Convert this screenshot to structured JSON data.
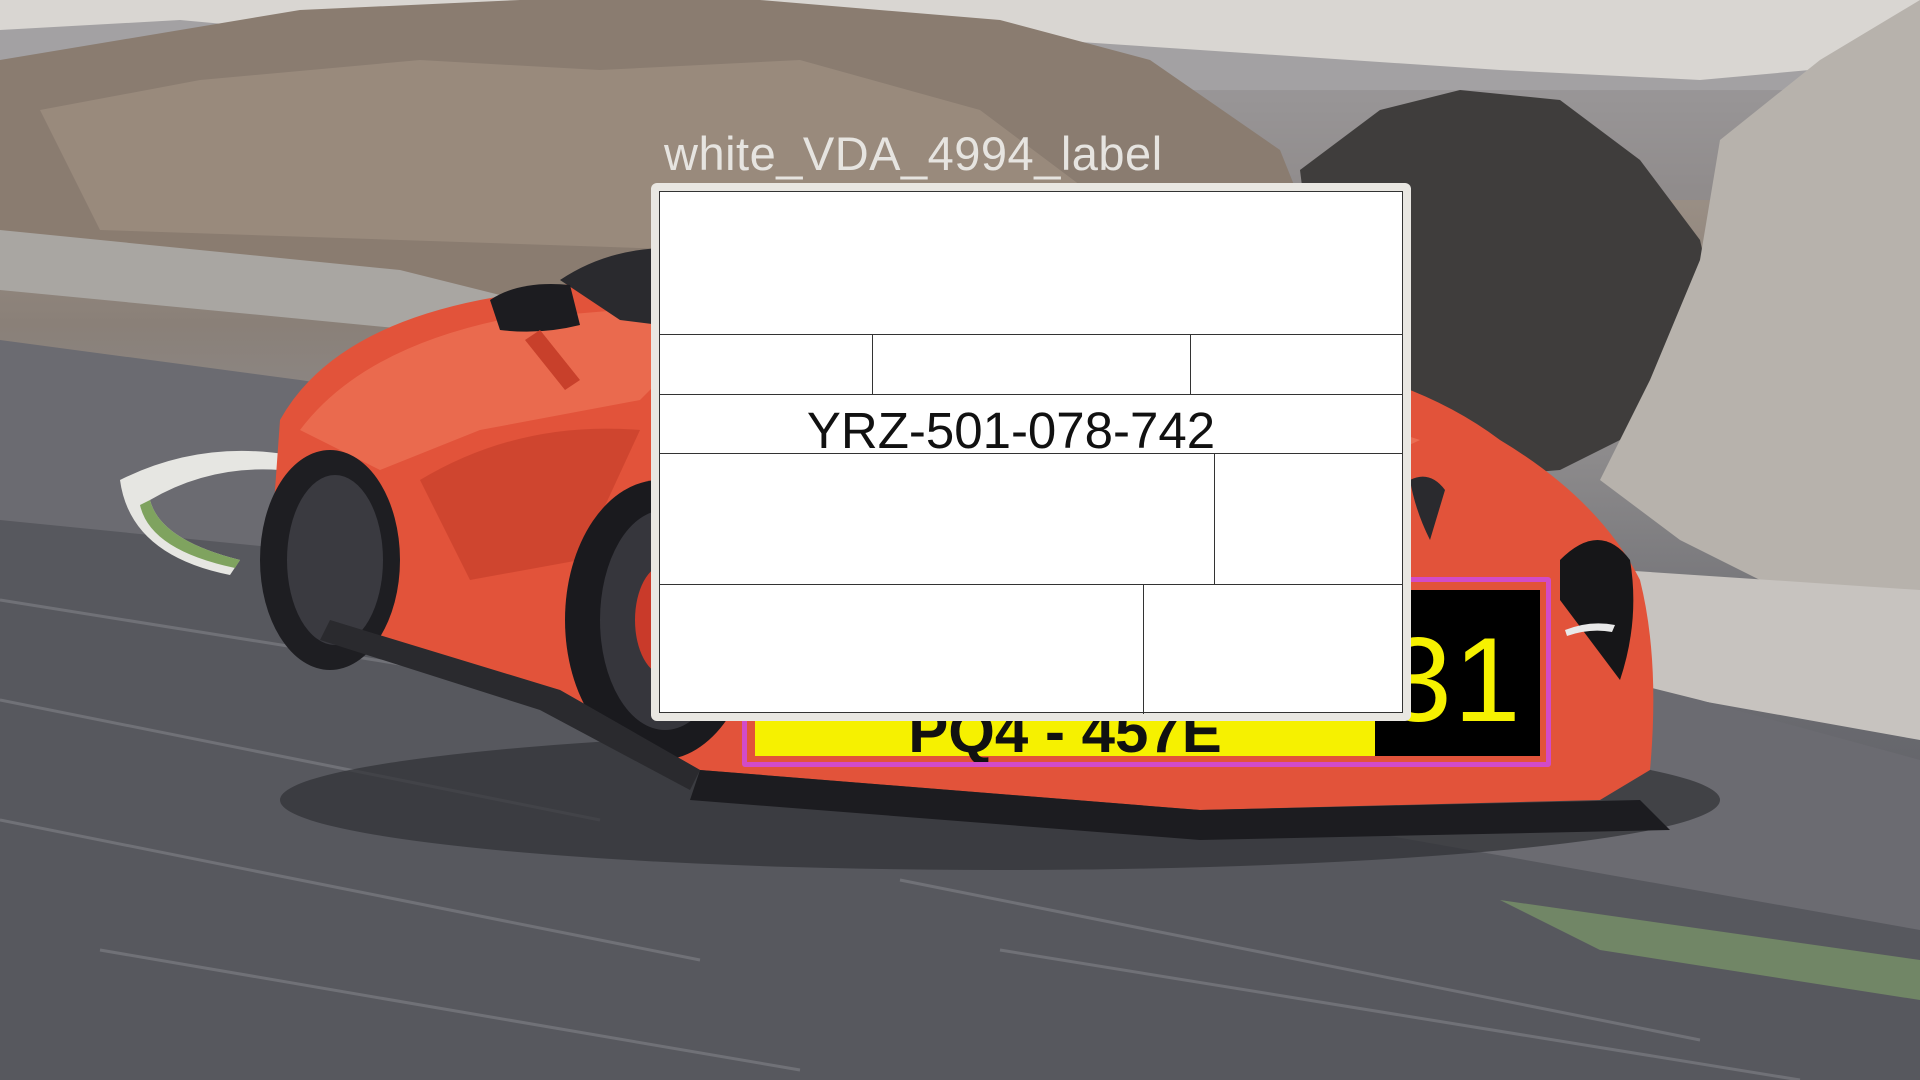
{
  "label": {
    "caption": "white_VDA_4994_label",
    "code": "YRZ-501-078-742"
  },
  "plate": {
    "main_text": "PQ4 - 457E",
    "side_text": "31"
  },
  "colors": {
    "plate_border": "#d24bc8",
    "plate_yellow": "#f6f100",
    "plate_black": "#000000",
    "car_body": "#e2533a"
  }
}
